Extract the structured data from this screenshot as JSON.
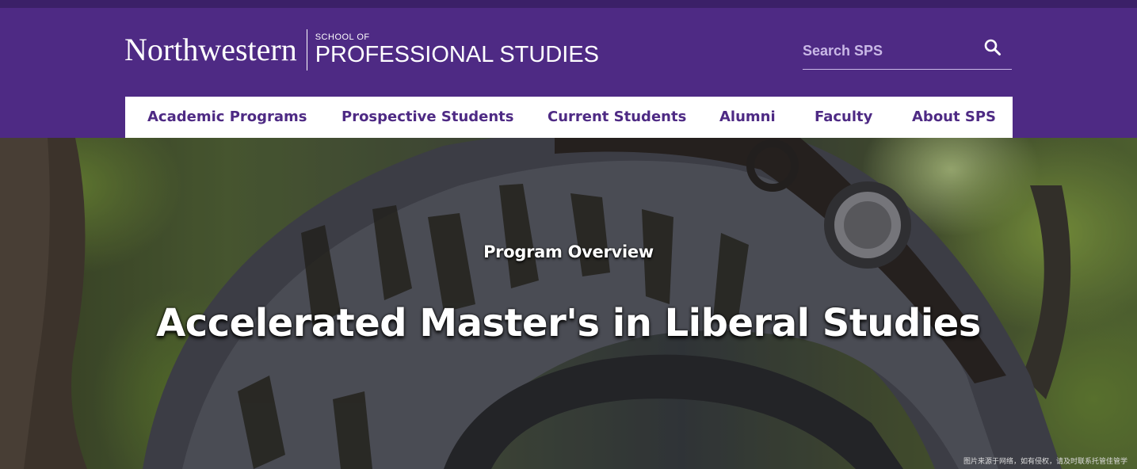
{
  "header": {
    "logo": {
      "wordmark": "Northwestern",
      "school_small": "SCHOOL OF",
      "school_big": "PROFESSIONAL STUDIES"
    },
    "search": {
      "placeholder": "Search SPS",
      "icon": "search-icon"
    },
    "colors": {
      "brand_purple": "#4e2a84",
      "top_strip": "#3b2068"
    }
  },
  "nav": {
    "items": [
      {
        "label": "Academic Programs"
      },
      {
        "label": "Prospective Students"
      },
      {
        "label": "Current Students"
      },
      {
        "label": "Alumni"
      },
      {
        "label": "Faculty"
      },
      {
        "label": "About SPS"
      }
    ]
  },
  "hero": {
    "eyebrow": "Program Overview",
    "title": "Accelerated Master's in Liberal Studies",
    "credit": "图片来源于网络，如有侵权，请及时联系托管佳管学"
  }
}
